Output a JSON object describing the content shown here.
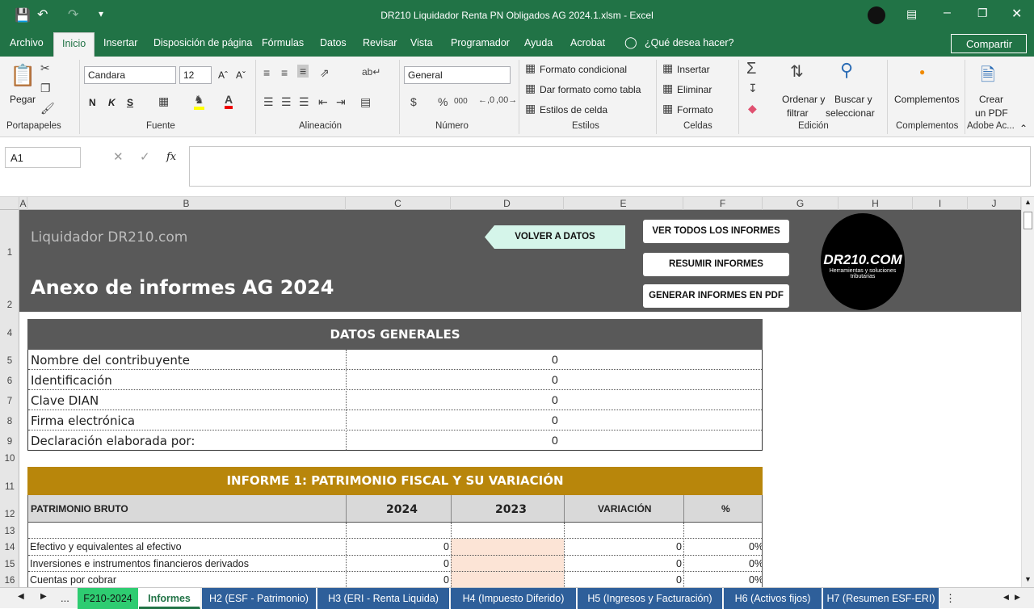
{
  "window": {
    "title": "DR210 Liquidador Renta PN Obligados AG 2024.1.xlsm  -  Excel"
  },
  "menu": [
    "Archivo",
    "Inicio",
    "Insertar",
    "Disposición de página",
    "Fórmulas",
    "Datos",
    "Revisar",
    "Vista",
    "Programador",
    "Ayuda",
    "Acrobat"
  ],
  "menu_tell": "¿Qué desea hacer?",
  "share": "Compartir",
  "ribbon": {
    "paste": "Pegar",
    "font_name": "Candara",
    "font_size": "12",
    "bold": "N",
    "italic": "K",
    "underline": "S",
    "number_format": "General",
    "cond_format": "Formato condicional",
    "table_format": "Dar formato como tabla",
    "cell_styles": "Estilos de celda",
    "insert": "Insertar",
    "delete": "Eliminar",
    "format": "Formato",
    "sort1": "Ordenar y",
    "sort2": "filtrar",
    "find1": "Buscar y",
    "find2": "seleccionar",
    "addins": "Complementos",
    "pdf1": "Crear",
    "pdf2": "un PDF",
    "groups": [
      "Portapapeles",
      "Fuente",
      "Alineación",
      "Número",
      "Estilos",
      "Celdas",
      "Edición",
      "Complementos",
      "Adobe Ac..."
    ]
  },
  "formula_bar": {
    "name_box": "A1",
    "fx": "fx",
    "value": ""
  },
  "columns": [
    "A",
    "B",
    "C",
    "D",
    "E",
    "F",
    "G",
    "H",
    "I",
    "J"
  ],
  "rows": [
    "1",
    "2",
    "4",
    "5",
    "6",
    "7",
    "8",
    "9",
    "10",
    "11",
    "12",
    "13",
    "14",
    "15",
    "16"
  ],
  "banner": {
    "brand": "Liquidador DR210.com",
    "title": "Anexo de informes AG 2024",
    "back_btn": "VOLVER A DATOS",
    "btn_all": "VER TODOS LOS INFORMES",
    "btn_summary": "RESUMIR INFORMES",
    "btn_pdf": "GENERAR INFORMES EN PDF",
    "logo_main": "DR210.COM",
    "logo_sub1": "Herramientas y soluciones",
    "logo_sub2": "tributarias"
  },
  "datos": {
    "header": "DATOS GENERALES",
    "rows": [
      {
        "label": "Nombre del contribuyente",
        "value": "0"
      },
      {
        "label": "Identificación",
        "value": "0"
      },
      {
        "label": "Clave DIAN",
        "value": "0"
      },
      {
        "label": "Firma electrónica",
        "value": "0"
      },
      {
        "label": "Declaración elaborada por:",
        "value": "0"
      }
    ]
  },
  "informe1": {
    "header": "INFORME 1: PATRIMONIO FISCAL Y SU VARIACIÓN",
    "col_label": "PATRIMONIO BRUTO",
    "col_2024": "2024",
    "col_2023": "2023",
    "col_var": "VARIACIÓN",
    "col_pct": "%",
    "rows": [
      {
        "label": "Efectivo y equivalentes al efectivo",
        "v2024": "0",
        "v2023": "",
        "var": "0",
        "pct": "0%"
      },
      {
        "label": "Inversiones e instrumentos financieros derivados",
        "v2024": "0",
        "v2023": "",
        "var": "0",
        "pct": "0%"
      },
      {
        "label": "Cuentas por cobrar",
        "v2024": "0",
        "v2023": "",
        "var": "0",
        "pct": "0%"
      }
    ]
  },
  "tabs": [
    "F210-2024",
    "Informes",
    "H2 (ESF - Patrimonio)",
    "H3 (ERI - Renta Liquida)",
    "H4 (Impuesto Diferido)",
    "H5 (Ingresos y Facturación)",
    "H6 (Activos fijos)",
    "H7 (Resumen ESF-ERI)"
  ],
  "tabs_more": "..."
}
